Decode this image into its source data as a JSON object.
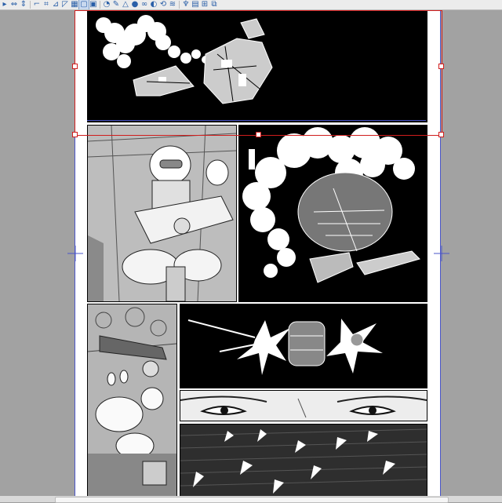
{
  "toolbar": {
    "tools": [
      {
        "name": "ruler-arrow-icon",
        "glyph": "▸"
      },
      {
        "name": "flip-horizontal-icon",
        "glyph": "⇔"
      },
      {
        "name": "flip-vertical-icon",
        "glyph": "⇕"
      },
      {
        "name": "ruler-corner-icon",
        "glyph": "⌐"
      },
      {
        "name": "perspective-ruler-icon",
        "glyph": "⌗"
      },
      {
        "name": "symmetry-ruler-icon",
        "glyph": "⊿"
      },
      {
        "name": "frame-border-icon",
        "glyph": "◸"
      },
      {
        "name": "grid-ruler-icon",
        "glyph": "▦"
      },
      {
        "name": "page-icon",
        "glyph": "▢"
      },
      {
        "name": "pages-icon",
        "glyph": "▣"
      },
      {
        "name": "bucket-icon",
        "glyph": "◔"
      },
      {
        "name": "pen-icon",
        "glyph": "✎"
      },
      {
        "name": "triangle-ruler-icon",
        "glyph": "△"
      },
      {
        "name": "sphere-icon",
        "glyph": "●"
      },
      {
        "name": "link-icon",
        "glyph": "∞"
      },
      {
        "name": "shape-icon",
        "glyph": "◐"
      },
      {
        "name": "curve-icon",
        "glyph": "⟲"
      },
      {
        "name": "stripes-icon",
        "glyph": "≋"
      },
      {
        "name": "tree-icon",
        "glyph": "♆"
      },
      {
        "name": "boxes-icon",
        "glyph": "▤"
      },
      {
        "name": "crop-icon",
        "glyph": "⊞"
      },
      {
        "name": "layers-icon",
        "glyph": "⧉"
      }
    ]
  },
  "colors": {
    "workspace": "#a2a2a2",
    "guide": "#4a55c8",
    "selection": "#d01d1d"
  },
  "canvas": {
    "panels": [
      {
        "name": "panel-1-spaceship-smoke"
      },
      {
        "name": "panel-2-pilot-cockpit"
      },
      {
        "name": "panel-3-ship-exploding"
      },
      {
        "name": "panel-4-hand-controls"
      },
      {
        "name": "panel-5-ship-firing"
      },
      {
        "name": "panel-6-eyes-closeup"
      },
      {
        "name": "panel-7-debris-streaks"
      }
    ]
  }
}
